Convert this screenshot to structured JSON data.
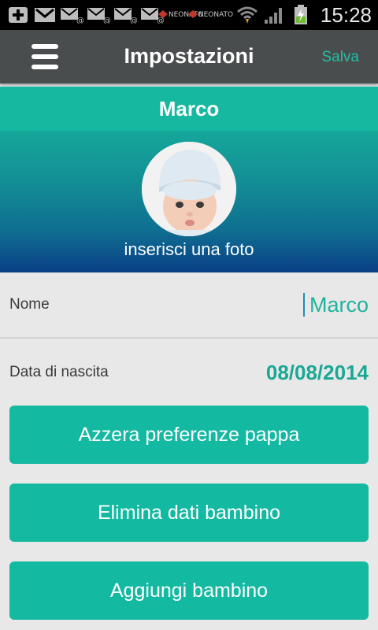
{
  "status_bar": {
    "time": "15:28",
    "left_icons": [
      "add-icon",
      "gmail-icon",
      "email-icon",
      "email-icon",
      "email-icon",
      "email-icon"
    ],
    "notif_labels": [
      "NEONATO",
      "NEONATO"
    ]
  },
  "toolbar": {
    "title": "Impostazioni",
    "save_label": "Salva"
  },
  "child": {
    "name_banner": "Marco",
    "photo_caption": "inserisci una foto"
  },
  "form": {
    "name_label": "Nome",
    "name_value": "Marco",
    "birth_label": "Data di nascita",
    "birth_value": "08/08/2014"
  },
  "actions": {
    "reset_prefs": "Azzera preferenze pappa",
    "delete_child": "Elimina dati bambino",
    "add_child": "Aggiungi bambino"
  },
  "colors": {
    "accent": "#17b8a0",
    "toolbar": "#4a4d4e",
    "background": "#e8e8e8"
  }
}
